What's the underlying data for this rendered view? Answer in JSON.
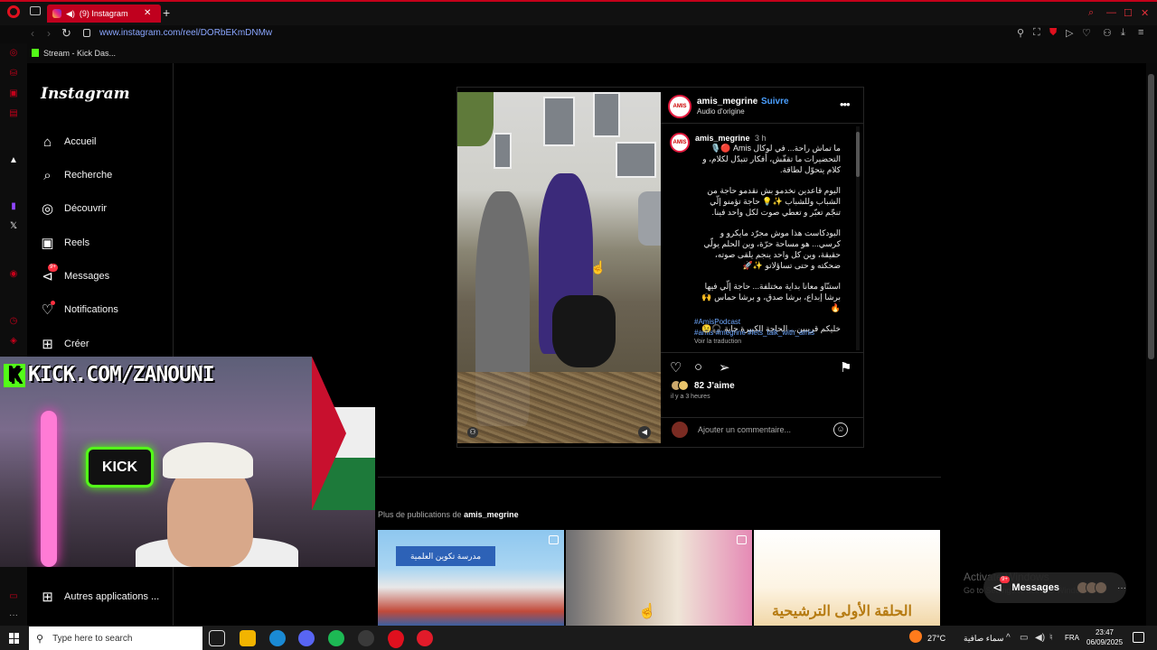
{
  "browser": {
    "tab_title": "(9) Instagram",
    "url": "www.instagram.com/reel/DORbEKmDNMw",
    "bookmark_label": "Stream - Kick Das..."
  },
  "nav": {
    "logo": "Instagram",
    "items": [
      {
        "label": "Accueil",
        "icon": "home-icon"
      },
      {
        "label": "Recherche",
        "icon": "search-icon"
      },
      {
        "label": "Découvrir",
        "icon": "compass-icon"
      },
      {
        "label": "Reels",
        "icon": "reels-icon"
      },
      {
        "label": "Messages",
        "icon": "messenger-icon",
        "badge": "9+"
      },
      {
        "label": "Notifications",
        "icon": "heart-icon"
      },
      {
        "label": "Créer",
        "icon": "plus-square-icon"
      }
    ],
    "more_apps": "Autres applications ..."
  },
  "post": {
    "username": "amis_megrine",
    "follow_sep": "•",
    "follow": "Suivre",
    "audio": "Audio d'origine",
    "avatar_text": "AMIS",
    "caption_time": "3 h",
    "caption": [
      "ما تماش راحة... في لوكال Amis 🔴🎙️ التحضيرات ما تقفّش، أفكار تتبدّل لكلام، و كلام يتحوّل لطاقة.",
      "اليوم قاعدين نخدمو بش نقدمو حاجة من الشباب وللشباب ✨💡 حاجة تؤمنو إلّي تنجّم تعبّر و تعطي صوت لكل واحد فينا.",
      "البودكاست هذا موش مجرّد مايكرو و كرسي... هو مساحة حرّة، وين الحلم يولّي حقيقة، وين كل واحد ينجم يلقى صوته، ضحكته و حتى تساؤلاتو ✨🚀",
      "استنّاو معانا بداية مختلفة... حاجة إلّي فيها برشا إبداع، برشا صدق، و برشا حماس 🙌🔥",
      "خليكم قريبين... الحاجة الكبيرة جاية 🎧😉"
    ],
    "hashtags_line1": "#AmisPodcast",
    "hashtags_line2": "#amis #megrine #lets_talk_with_amis",
    "see_translation": "Voir la traduction",
    "likes": "82 J'aime",
    "posted_ago": "il y a 3 heures",
    "comment_placeholder": "Ajouter un commentaire..."
  },
  "more_posts": {
    "label_prefix": "Plus de publications de ",
    "username": "amis_megrine",
    "thumb1_sign": "مدرسة تكوين العلمية",
    "thumb3_text": "الحلقة الأولى الترشيحية"
  },
  "stream_overlay": {
    "logo_text": "KICK.COM/ZANOUNI",
    "neon_sign": "KICK"
  },
  "windows": {
    "activate_title": "Activate Windows",
    "activate_sub": "Go to Settings to activate Windows.",
    "search_placeholder": "Type here to search",
    "temperature": "27°C",
    "weather": "سماء صافية",
    "lang": "FRA",
    "time": "23:47",
    "date": "06/09/2025"
  },
  "messages_pill": {
    "label": "Messages",
    "badge": "9+"
  },
  "colors": {
    "accent": "#0095f6",
    "opera_red": "#c4001a",
    "kick_green": "#53fc18"
  }
}
